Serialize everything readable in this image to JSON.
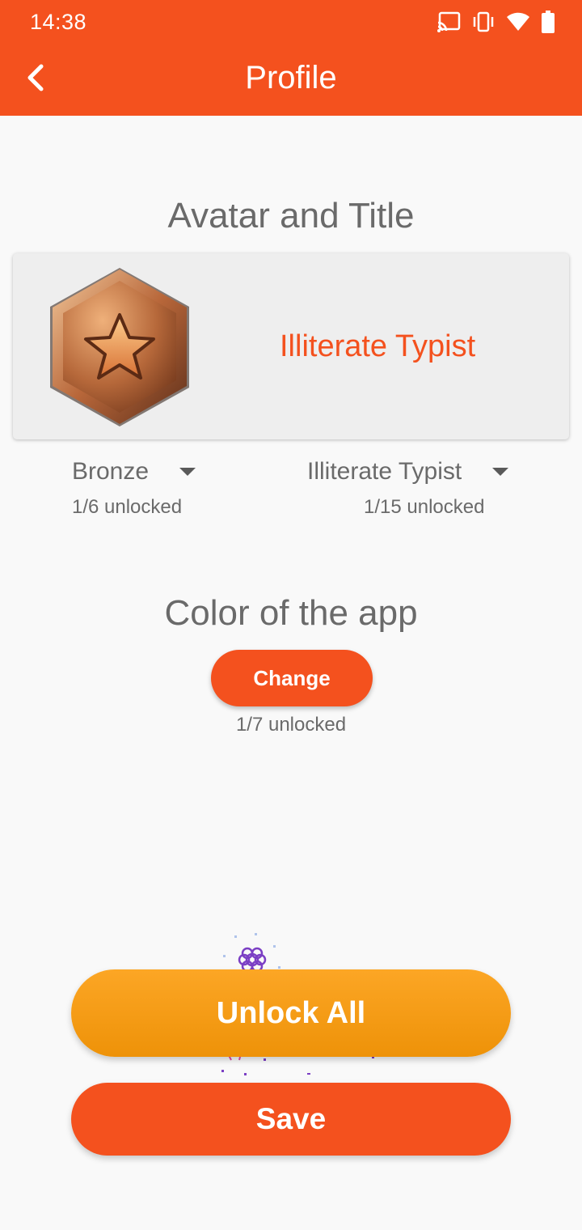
{
  "status_bar": {
    "time": "14:38",
    "icons": [
      "cast-icon",
      "vibrate-icon",
      "wifi-icon",
      "battery-icon"
    ]
  },
  "app_bar": {
    "title": "Profile",
    "back_icon": "chevron-left-icon",
    "color": "#f4511e"
  },
  "avatar_section": {
    "heading": "Avatar and Title",
    "selected_title": "Illiterate Typist",
    "badge_icon": "bronze-star-badge-icon",
    "avatar_dropdown": {
      "value": "Bronze",
      "progress": "1/6 unlocked"
    },
    "title_dropdown": {
      "value": "Illiterate Typist",
      "progress": "1/15 unlocked"
    }
  },
  "color_section": {
    "heading": "Color of the app",
    "change_label": "Change",
    "progress": "1/7 unlocked"
  },
  "actions": {
    "unlock_all_label": "Unlock All",
    "save_label": "Save"
  },
  "colors": {
    "accent": "#f4511e",
    "unlock": "#f7a01a",
    "text_secondary": "#6a6a6a",
    "card": "#eeeeee"
  }
}
